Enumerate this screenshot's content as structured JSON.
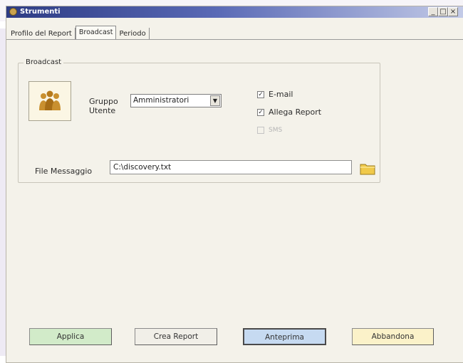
{
  "window": {
    "title": "Strumenti",
    "controls": [
      "_",
      "□",
      "×"
    ]
  },
  "tabs": [
    {
      "label": "Profilo del Report",
      "active": false
    },
    {
      "label": "Broadcast",
      "active": true
    },
    {
      "label": "Periodo",
      "active": false
    }
  ],
  "broadcast": {
    "group_label": "Broadcast",
    "user_group_label_line1": "Gruppo",
    "user_group_label_line2": "Utente",
    "user_group_value": "Amministratori",
    "checkboxes": [
      {
        "label": "E-mail",
        "checked": true,
        "enabled": true
      },
      {
        "label": "Allega Report",
        "checked": true,
        "enabled": true
      },
      {
        "label": "SMS",
        "checked": false,
        "enabled": false
      }
    ],
    "file_label": "File Messaggio",
    "file_value": "C:\\discovery.txt"
  },
  "buttons": {
    "apply": "Applica",
    "create_report": "Crea Report",
    "preview": "Anteprima",
    "cancel": "Abbandona"
  },
  "colors": {
    "apply_bg": "#d2ebc9",
    "create_bg": "#f1efe8",
    "preview_bg": "#c6daf1",
    "cancel_bg": "#fbf2c9"
  },
  "icons": {
    "user_group": "user-group-icon",
    "folder": "folder-icon",
    "app": "app-icon"
  }
}
